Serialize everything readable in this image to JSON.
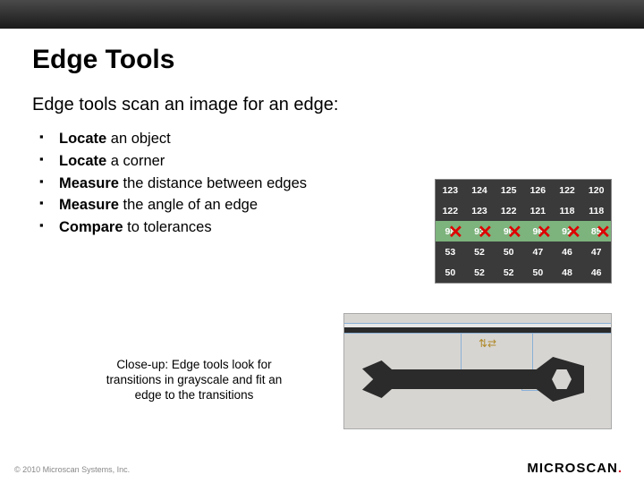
{
  "title": "Edge Tools",
  "subtitle": "Edge tools scan an image for an edge:",
  "bullets": [
    {
      "bold": "Locate",
      "rest": " an object"
    },
    {
      "bold": "Locate",
      "rest": " a corner"
    },
    {
      "bold": "Measure",
      "rest": " the distance between edges"
    },
    {
      "bold": "Measure",
      "rest": " the angle of an edge"
    },
    {
      "bold": "Compare",
      "rest": " to tolerances"
    }
  ],
  "closeup_caption": "Close-up: Edge tools look for transitions in grayscale and fit an edge to the transitions",
  "pixel_grid": {
    "rows": [
      [
        "123",
        "124",
        "125",
        "126",
        "122",
        "120"
      ],
      [
        "122",
        "123",
        "122",
        "121",
        "118",
        "118"
      ],
      [
        "98",
        "93",
        "90",
        "96",
        "92",
        "85"
      ],
      [
        "53",
        "52",
        "50",
        "47",
        "46",
        "47"
      ],
      [
        "50",
        "52",
        "52",
        "50",
        "48",
        "46"
      ]
    ]
  },
  "footer": "© 2010 Microscan Systems, Inc.",
  "brand_main": "MICROSCAN",
  "brand_dot": "."
}
